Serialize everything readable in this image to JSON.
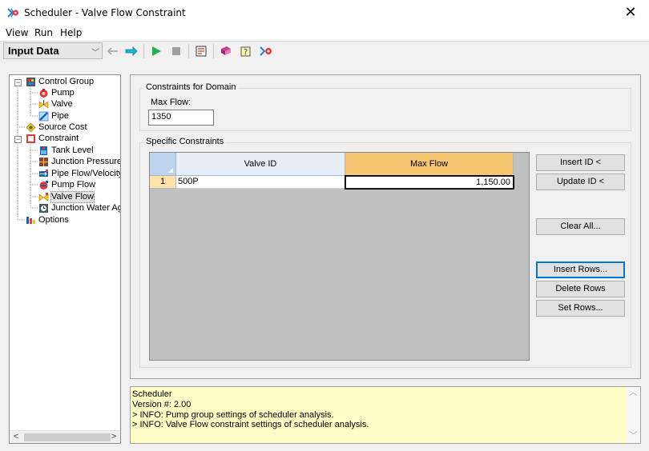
{
  "window": {
    "title": "Scheduler - Valve Flow Constraint",
    "close_glyph": "✕"
  },
  "menu": [
    {
      "label": "View"
    },
    {
      "label": "Run"
    },
    {
      "label": "Help"
    }
  ],
  "toolbar": {
    "view_select": "Input Data"
  },
  "tree": {
    "items": [
      {
        "label": "Control Group",
        "icon": "control-group-icon"
      },
      {
        "label": "Pump",
        "icon": "pump-icon"
      },
      {
        "label": "Valve",
        "icon": "valve-icon"
      },
      {
        "label": "Pipe",
        "icon": "pipe-icon"
      },
      {
        "label": "Source Cost",
        "icon": "source-cost-icon"
      },
      {
        "label": "Constraint",
        "icon": "constraint-icon"
      },
      {
        "label": "Tank Level",
        "icon": "tank-level-icon"
      },
      {
        "label": "Junction Pressure",
        "icon": "junction-pressure-icon"
      },
      {
        "label": "Pipe Flow/Velocity",
        "icon": "pipe-flow-velocity-icon"
      },
      {
        "label": "Pump Flow",
        "icon": "pump-flow-icon"
      },
      {
        "label": "Valve Flow",
        "icon": "valve-flow-icon",
        "selected": true
      },
      {
        "label": "Junction Water Age",
        "icon": "junction-water-age-icon"
      },
      {
        "label": "Options",
        "icon": "options-icon"
      }
    ]
  },
  "domain": {
    "group_title": "Constraints for Domain",
    "max_flow_label": "Max Flow:",
    "max_flow_value": "1350"
  },
  "specific": {
    "group_title": "Specific Constraints",
    "columns": [
      "Valve ID",
      "Max Flow"
    ],
    "rows": [
      {
        "num": "1",
        "valve_id": "500P",
        "max_flow": "1,150.00"
      }
    ]
  },
  "buttons": {
    "insert_id": "Insert ID <",
    "update_id": "Update ID <",
    "clear_all": "Clear All...",
    "insert_rows": "Insert Rows...",
    "delete_rows": "Delete Rows",
    "set_rows": "Set Rows..."
  },
  "log": {
    "lines": [
      "Scheduler",
      "Version #: 2.00",
      "> INFO: Pump group settings of scheduler analysis.",
      "> INFO: Valve Flow constraint settings of scheduler analysis."
    ]
  }
}
